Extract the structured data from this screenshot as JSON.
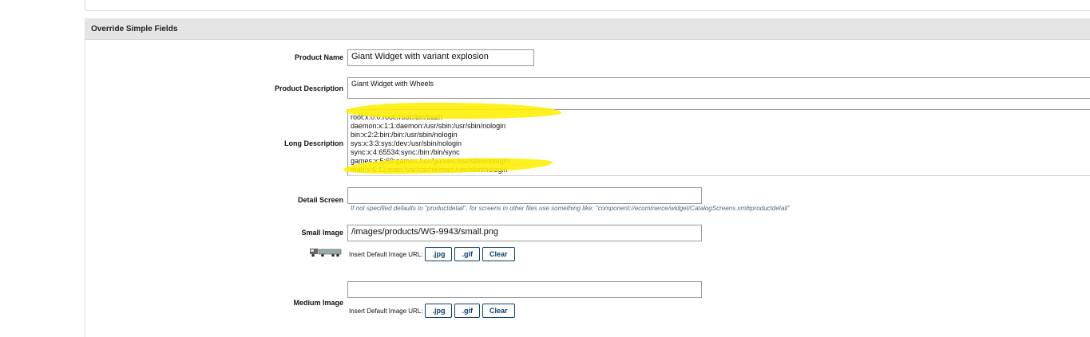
{
  "section": {
    "title": "Override Simple Fields"
  },
  "fields": {
    "product_name": {
      "label": "Product Name",
      "value": "Giant Widget with variant explosion"
    },
    "product_description": {
      "label": "Product Description",
      "value": "Giant Widget with Wheels"
    },
    "long_description": {
      "label": "Long Description",
      "lines": [
        "root:x:0:0:root:/root:/bin/bash",
        "daemon:x:1:1:daemon:/usr/sbin:/usr/sbin/nologin",
        "bin:x:2:2:bin:/bin:/usr/sbin/nologin",
        "sys:x:3:3:sys:/dev:/usr/sbin/nologin",
        "sync:x:4:65534:sync:/bin:/bin/sync",
        "games:x:5:60:games:/usr/games:/usr/sbin/nologin",
        "man:x:6:12:man:/var/cache/man:/usr/sbin/nologin"
      ]
    },
    "detail_screen": {
      "label": "Detail Screen",
      "value": "",
      "hint": "If not specified defaults to \"productdetail\", for screens in other files use something like: \"component://ecommerce/widget/CatalogScreens.xml#productdetail\""
    },
    "small_image": {
      "label": "Small Image",
      "value": "/images/products/WG-9943/small.png"
    },
    "medium_image": {
      "label": "Medium Image",
      "value": ""
    }
  },
  "image_buttons": {
    "insert_label": "Insert Default Image URL:",
    "jpg": ".jpg",
    "gif": ".gif",
    "clear": "Clear"
  },
  "colors": {
    "highlight": "#ffef00",
    "button_border": "#0d3e6b",
    "header_bg": "#e5e5e5"
  }
}
